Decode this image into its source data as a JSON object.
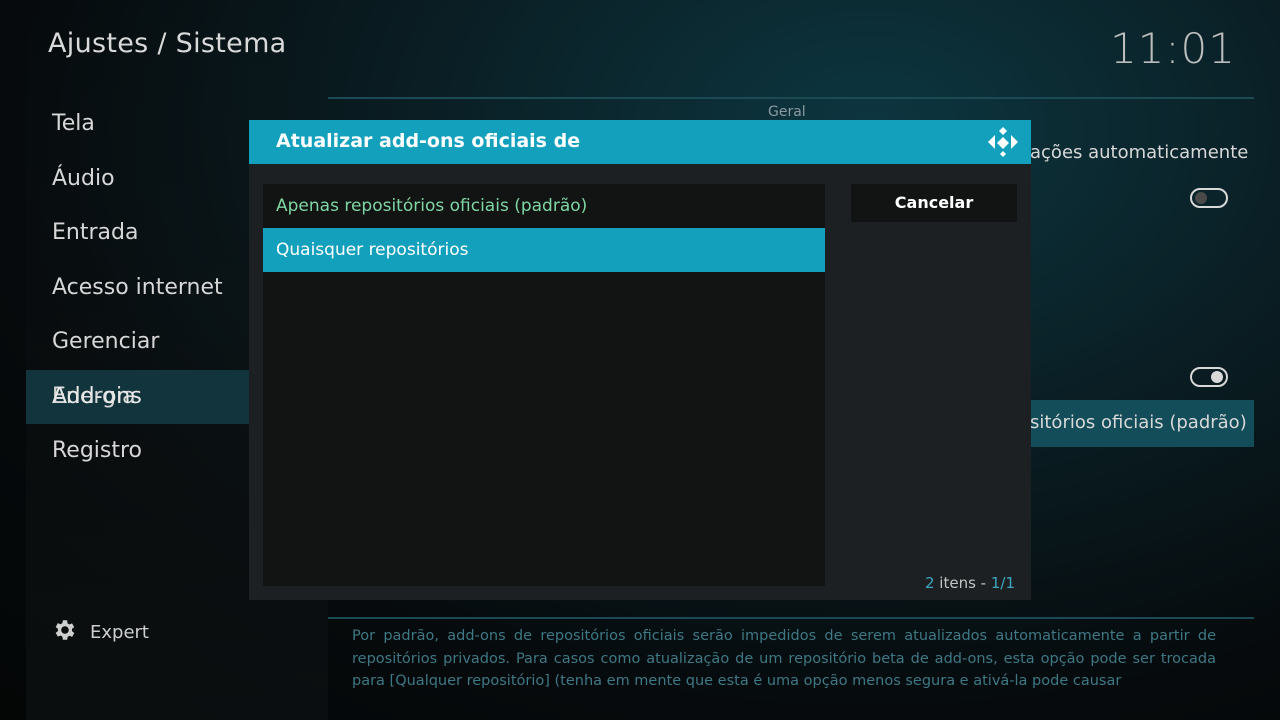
{
  "header": {
    "title": "Ajustes / Sistema",
    "clock": "11:01"
  },
  "sidebar": {
    "items": [
      {
        "label": "Tela"
      },
      {
        "label": "Áudio"
      },
      {
        "label": "Entrada"
      },
      {
        "label": "Acesso internet"
      },
      {
        "label": "Gerenciar Energia"
      },
      {
        "label": "Add-ons",
        "active": true
      },
      {
        "label": "Registro"
      }
    ],
    "expert_label": "Expert",
    "expert_icon": "gear-icon"
  },
  "settings": {
    "section_label": "Geral",
    "visible_text_1": "ações automaticamente",
    "toggle_1_on": false,
    "toggle_2_on": true,
    "selected_value_partial": "sitórios oficiais (padrão)",
    "description": "Por padrão, add-ons de repositórios oficiais serão impedidos de serem atualizados automaticamente a partir de repositórios privados. Para casos como atualização de um repositório beta de add-ons, esta opção pode ser trocada para [Qualquer repositório] (tenha em mente que esta é uma opção menos segura e ativá-la pode causar"
  },
  "dialog": {
    "title": "Atualizar add-ons oficiais de",
    "logo_icon": "kodi-logo-icon",
    "options": [
      {
        "label": "Apenas repositórios oficiais (padrão)",
        "state": "current"
      },
      {
        "label": "Quaisquer repositórios",
        "state": "focused"
      }
    ],
    "cancel_label": "Cancelar",
    "count_number": "2",
    "count_word": " itens - ",
    "page": "1/1"
  },
  "colors": {
    "accent": "#12a0bd",
    "current_option": "#7fd6a4",
    "description_text": "#3e7884"
  }
}
